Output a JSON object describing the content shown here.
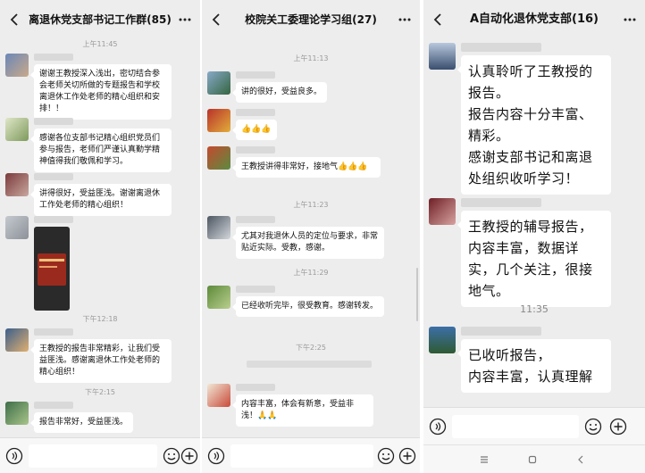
{
  "panels": [
    {
      "title": "离退休党支部书记工作群(85)",
      "messages": [
        {
          "time": "上午11:45"
        },
        {
          "text": "谢谢王教授深入浅出，密切结合参会老师关切所做的专题报告和学校离退休工作处老师的精心组织和安排！！"
        },
        {
          "text": "感谢各位支部书记精心组织党员们参与报告，老师们严谨认真勤学精神值得我们敬佩和学习。"
        },
        {
          "text": "讲得很好，受益匪浅。谢谢离退休工作处老师的精心组织！"
        },
        {
          "time": "下午12:18"
        },
        {
          "text": "王教授的报告非常精彩，让我们受益匪浅。感谢离退休工作处老师的精心组织！"
        },
        {
          "time": "下午2:15"
        },
        {
          "text": "报告非常好，受益匪浅。"
        }
      ]
    },
    {
      "title": "校院关工委理论学习组(27)",
      "messages": [
        {
          "time": "上午11:13"
        },
        {
          "text": "讲的很好，受益良多。"
        },
        {
          "text": "👍👍👍"
        },
        {
          "text": "王教授讲得非常好，接地气👍👍👍"
        },
        {
          "time": "上午11:23"
        },
        {
          "text": "尤其对我退休人员的定位与要求，非常贴近实际。受教，感谢。"
        },
        {
          "time": "上午11:29"
        },
        {
          "text": "已经收听完毕，很受教育。感谢转发。"
        },
        {
          "time": "下午2:25"
        },
        {
          "text": "内容丰富，体会有新意，受益非浅！🙏🙏"
        }
      ]
    },
    {
      "title": "A自动化退休党支部(16)",
      "messages": [
        {
          "text": "认真聆听了王教授的报告。\n报告内容十分丰富、精彩。\n感谢支部书记和离退处组织收听学习！"
        },
        {
          "text": "王教授的辅导报告，内容丰富，数据详实，几个关注，很接地气。"
        },
        {
          "time": "11:35"
        },
        {
          "text": "已收听报告，\n内容丰富，认真理解"
        }
      ]
    }
  ],
  "icons": {
    "back": "back-arrow-icon",
    "more": "more-dots-icon",
    "voice": "voice-icon",
    "emoji": "emoji-icon",
    "plus": "plus-icon",
    "nav_menu": "nav-menu-icon",
    "nav_home": "nav-home-icon",
    "nav_back": "nav-back-icon"
  },
  "colors": {
    "chat_bg": "#ededed",
    "bubble": "#ffffff",
    "timestamp": "#9a9a9a"
  }
}
